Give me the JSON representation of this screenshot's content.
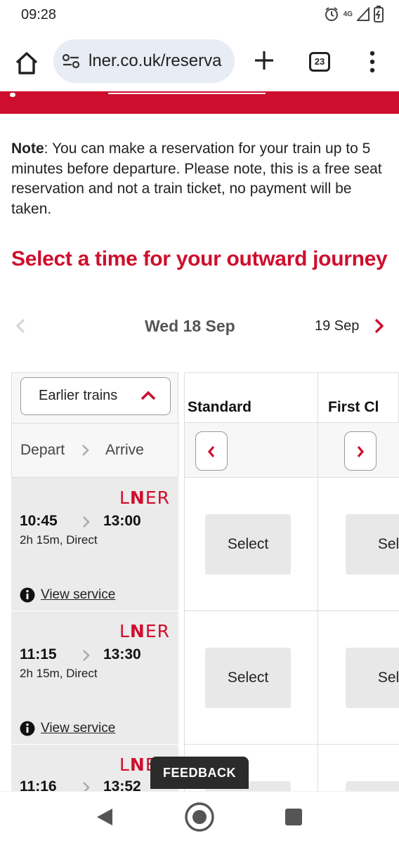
{
  "status_bar": {
    "time": "09:28",
    "network": "4G"
  },
  "browser": {
    "url": "lner.co.uk/reserva",
    "tab_count": "23"
  },
  "note": {
    "label": "Note",
    "text": ": You can make a reservation for your train up to 5 minutes before departure. Please note, this is a free seat reservation and not a train ticket, no payment will be taken."
  },
  "heading": "Select a time for your outward journey",
  "date_nav": {
    "current": "Wed 18 Sep",
    "next": "19 Sep"
  },
  "table": {
    "earlier_label": "Earlier trains",
    "depart_label": "Depart",
    "arrive_label": "Arrive",
    "col_standard": "Standard",
    "col_first": "First Cl",
    "trains": [
      {
        "operator": "LNER",
        "depart": "10:45",
        "arrive": "13:00",
        "duration": "2h 15m, Direct",
        "view": "View service",
        "std_select": "Select",
        "first_select": "Sel"
      },
      {
        "operator": "LNER",
        "depart": "11:15",
        "arrive": "13:30",
        "duration": "2h 15m, Direct",
        "view": "View service",
        "std_select": "Select",
        "first_select": "Sel"
      },
      {
        "operator": "LNER",
        "depart": "11:16",
        "arrive": "13:52",
        "duration": "",
        "view": "",
        "std_select": "",
        "first_select": ""
      }
    ]
  },
  "feedback": "FEEDBACK",
  "colors": {
    "brand_red": "#ce0e2d",
    "cell_grey": "#ebebeb"
  }
}
